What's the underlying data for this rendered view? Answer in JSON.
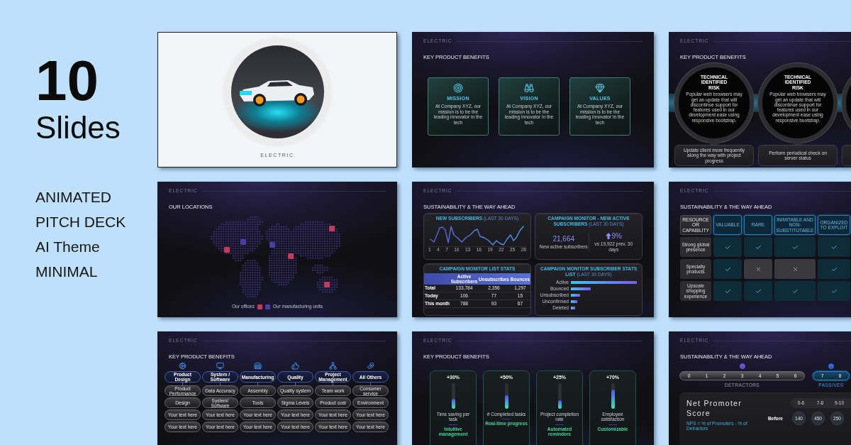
{
  "promo": {
    "count": "10",
    "unit": "Slides",
    "features": [
      "ANIMATED",
      "PITCH DECK",
      "AI Theme",
      "MINIMAL"
    ]
  },
  "slides": [
    {
      "kind": "cover",
      "brand": "ELECTRIC"
    },
    {
      "kind": "cards",
      "brand": "ELECTRIC",
      "title": "KEY PRODUCT BENEFITS",
      "cards": [
        {
          "title": "MISSION",
          "text": "At Company XYZ, our mission is to be the leading innovator in the tech"
        },
        {
          "title": "VISION",
          "text": "At Company XYZ, our mission is to be the leading innovator in the tech"
        },
        {
          "title": "VALUES",
          "text": "At Company XYZ, our mission is to be the leading innovator in the tech"
        }
      ]
    },
    {
      "kind": "circles",
      "brand": "ELECTRIC",
      "title": "KEY PRODUCT BENEFITS",
      "nodes": [
        {
          "title": "TECHNICAL IDENTIFIED RISK",
          "text": "Popular web browsers may get an update that will discontinue support for features used in our development ease using responsive bootstrap.",
          "note": "Update client more frequently along the way with project progress"
        },
        {
          "title": "TECHNICAL IDENTIFIED RISK",
          "text": "Popular web browsers may get an update that will discontinue support for features used in our development ease using responsive bootstrap.",
          "note": "Perform periodical check on server status"
        }
      ]
    },
    {
      "kind": "map",
      "brand": "ELECTRIC",
      "title": "OUR LOCATIONS",
      "markers": [
        {
          "color": "#c33a5f"
        },
        {
          "color": "#4b3fa3"
        },
        {
          "color": "#c33a5f"
        },
        {
          "color": "#4b3fa3"
        },
        {
          "color": "#c33a5f"
        },
        {
          "color": "#c33a5f"
        }
      ],
      "legend": [
        {
          "label": "Our offices",
          "color": "#c33a5f"
        },
        {
          "label": "Our manufacturing units",
          "color": "#4b3fa3"
        }
      ]
    },
    {
      "kind": "dashboard",
      "brand": "ELECTRIC",
      "title": "SUSTAINABILITY & THE WAY AHEAD",
      "trend": {
        "title": "NEW SUBSCRIBERS",
        "period": "(LAST 30 DAYS)",
        "x_labels": [
          "1",
          "4",
          "7",
          "10",
          "13",
          "16",
          "19",
          "22",
          "25",
          "28"
        ]
      },
      "kpi": {
        "title": "CAMPAIGN MONITOR - NEW ACTIVE SUBSCRIBERS",
        "period": "(LAST 30 DAYS)",
        "value": "21,664",
        "caption": "New active subscribers",
        "change": "9%",
        "change_caption": "vs 19,922 prev. 30 days"
      },
      "list_stats": {
        "title": "CAMPAIGN MONITOR LIST STATS",
        "columns": [
          "Active Subscribers",
          "Unsubscribes",
          "Bounces"
        ],
        "rows": [
          {
            "label": "Total",
            "cells": [
              "133,784",
              "2,356",
              "1,297"
            ]
          },
          {
            "label": "Today",
            "cells": [
              "106",
              "77",
              "15"
            ]
          },
          {
            "label": "This month",
            "cells": [
              "788",
              "93",
              "67"
            ]
          }
        ]
      },
      "subscriber_stats": {
        "title": "CAMPAIGN MONITOR SUBSCRIBER STATS LIST",
        "period": "(LAST 30 DAYS)",
        "bars": [
          "Active",
          "Bounced",
          "Unsubscribed",
          "Unconfirmed",
          "Deleted"
        ]
      }
    },
    {
      "kind": "matrix",
      "brand": "ELECTRIC",
      "title": "SUSTAINABILITY & THE WAY AHEAD",
      "corner": "RESOURCE OR CAPABILITY",
      "columns": [
        "VALUABLE",
        "RARE",
        "INIMITABLE AND NON-SUBSTITUTABLE",
        "ORGANIZED TO EXPLOIT"
      ],
      "rows": [
        {
          "label": "Strong global presence",
          "cells": [
            {
              "checked": true
            },
            {
              "checked": true
            },
            {
              "checked": true
            },
            {
              "checked": true
            }
          ]
        },
        {
          "label": "Specialty products",
          "cells": [
            {
              "checked": true
            },
            {
              "checked": false
            },
            {
              "checked": false
            },
            {
              "checked": true
            }
          ]
        },
        {
          "label": "Upscale shopping experience",
          "cells": [
            {
              "checked": true
            },
            {
              "checked": true
            },
            {
              "checked": true
            },
            {
              "checked": true
            }
          ]
        }
      ]
    },
    {
      "kind": "flow",
      "brand": "ELECTRIC",
      "title": "KEY PRODUCT BENEFITS",
      "columns": [
        {
          "title": "Product Design",
          "items": [
            "Product Performance",
            "Design",
            "Your text here",
            "Your text here"
          ]
        },
        {
          "title": "System / Software",
          "items": [
            "Data Accuracy",
            "System/ Software",
            "Your text here",
            "Your text here"
          ]
        },
        {
          "title": "Manufacturing",
          "items": [
            "Assembly",
            "Tools",
            "Your text here",
            "Your text here"
          ]
        },
        {
          "title": "Quality",
          "items": [
            "Quality system",
            "Sigma Levels",
            "Your text here",
            "Your text here"
          ]
        },
        {
          "title": "Project Management",
          "items": [
            "Team work",
            "Product cost",
            "Your text here",
            "Your text here"
          ]
        },
        {
          "title": "All Others",
          "items": [
            "Consumer service",
            "Environment",
            "Your text here",
            "Your text here"
          ]
        }
      ]
    },
    {
      "kind": "meters",
      "brand": "ELECTRIC",
      "title": "KEY PRODUCT BENEFITS",
      "meters": [
        {
          "value": "+30%",
          "level": 0.38,
          "label": "Time saving per task",
          "feature": "Intuitive management"
        },
        {
          "value": "+50%",
          "level": 0.54,
          "label": "# Completed tasks",
          "feature": "Real-time progress"
        },
        {
          "value": "+25%",
          "level": 0.32,
          "label": "Project completion rate",
          "feature": "Automated reminders"
        },
        {
          "value": "+70%",
          "level": 0.75,
          "label": "Employee satisfaction",
          "feature": "Customizable"
        }
      ]
    },
    {
      "kind": "nps",
      "brand": "ELECTRIC",
      "title": "SUSTAINABILITY & THE WAY AHEAD",
      "groups": [
        {
          "numbers": [
            "0",
            "1",
            "2",
            "3",
            "4",
            "5",
            "6"
          ],
          "label": "DETRACTORS",
          "color": "#7b52e8",
          "highlighted": false
        },
        {
          "numbers": [
            "7",
            "8"
          ],
          "label": "PASSIVES",
          "color": "#2f6fe8",
          "highlighted": true
        }
      ],
      "score_title": "Net Promoter Score",
      "formula": "NPS = % of Promoters - % of Detractors",
      "columns": [
        "0-6",
        "7-8",
        "9-10"
      ],
      "rows": [
        {
          "label": "Before",
          "cells": [
            "140",
            "450",
            "250"
          ]
        }
      ]
    }
  ]
}
